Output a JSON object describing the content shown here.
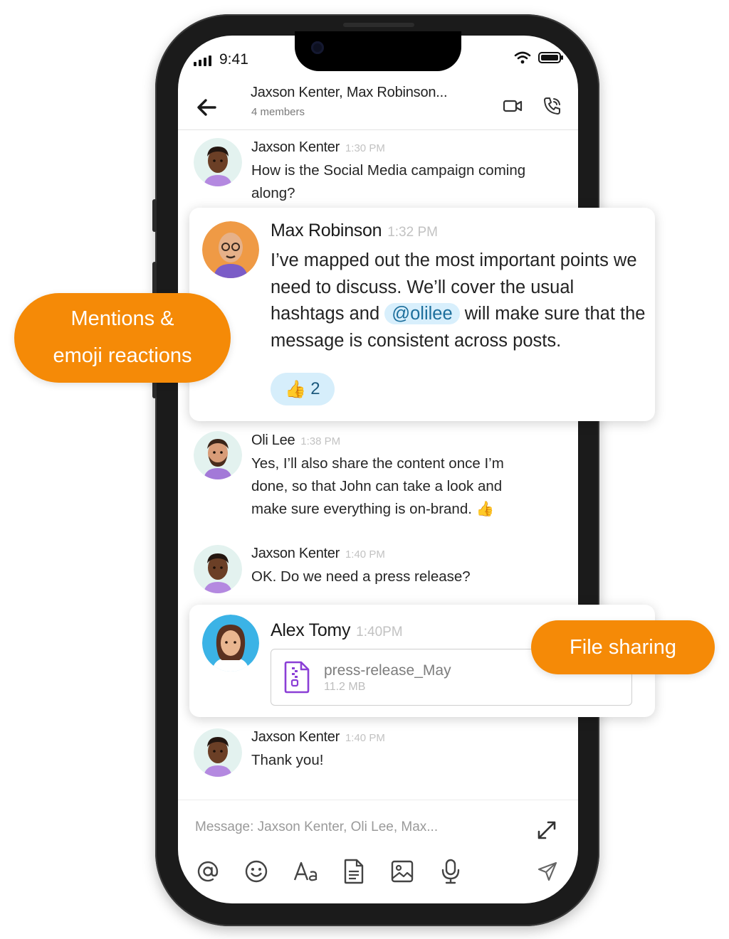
{
  "status_bar": {
    "time": "9:41"
  },
  "header": {
    "title": "Jaxson Kenter, Max Robinson...",
    "subtitle": "4 members"
  },
  "messages": [
    {
      "sender": "Jaxson Kenter",
      "time": "1:30 PM",
      "text": "How is the Social Media campaign coming along?"
    },
    {
      "sender": "Max Robinson",
      "time": "1:32 PM",
      "text_before": "I’ve mapped out the most important points we need to discuss. We’ll cover the usual hashtags and",
      "mention": "@olilee",
      "text_after": "will make sure that the message is consistent across posts.",
      "reaction": {
        "emoji": "👍",
        "count": "2"
      }
    },
    {
      "sender": "Oli Lee",
      "time": "1:38 PM",
      "text": "Yes, I’ll also share the content once I’m done, so that John can take a look and make sure everything is on-brand. 👍"
    },
    {
      "sender": "Jaxson Kenter",
      "time": "1:40 PM",
      "text": "OK. Do we need a press release?"
    },
    {
      "sender": "Alex Tomy",
      "time": "1:40PM",
      "file": {
        "name": "press-release_May",
        "size": "11.2 MB"
      }
    },
    {
      "sender": "Jaxson Kenter",
      "time": "1:40 PM",
      "text": "Thank you!"
    }
  ],
  "composer": {
    "placeholder": "Message: Jaxson Kenter, Oli Lee, Max..."
  },
  "callouts": {
    "mentions_line1": "Mentions &",
    "mentions_line2": "emoji reactions",
    "file_sharing": "File sharing"
  },
  "colors": {
    "accent_orange": "#f58a07",
    "mention_bg": "#d8effc",
    "file_icon": "#8b3fd6"
  }
}
